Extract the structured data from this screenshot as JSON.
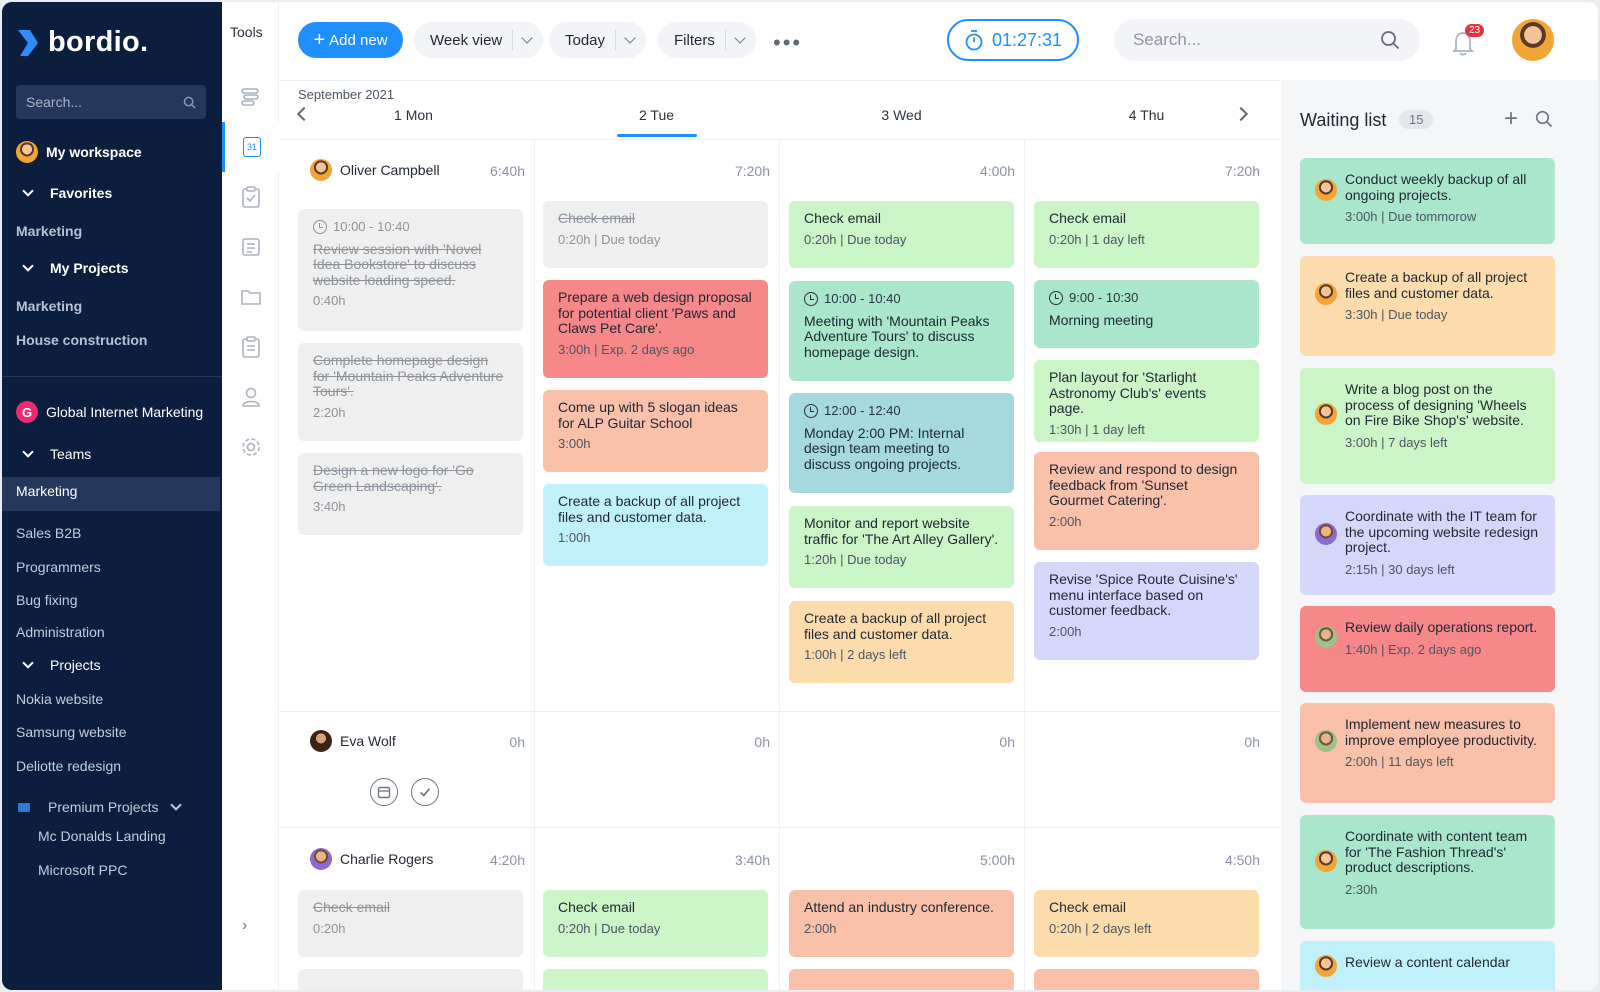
{
  "sidebar": {
    "brand": "bordio.",
    "search_placeholder": "Search...",
    "workspace": "My workspace",
    "favorites": "Favorites",
    "fav_items": [
      "Marketing"
    ],
    "my_projects": "My Projects",
    "project_items": [
      "Marketing",
      "House construction"
    ],
    "org_name": "Global Internet Marketing",
    "org_initial": "G",
    "teams": "Teams",
    "team_items": [
      "Marketing",
      "Sales B2B",
      "Programmers",
      "Bug fixing",
      "Administration"
    ],
    "projects": "Projects",
    "projects_items": [
      "Nokia website",
      "Samsung website",
      "Deliotte redesign"
    ],
    "premium_folder": "Premium Projects",
    "premium_items": [
      "Mc Donalds Landing",
      "Microsoft PPC"
    ]
  },
  "tools": {
    "title": "Tools",
    "calendar_day": "31"
  },
  "toolbar": {
    "add_label": "Add new",
    "view_label": "Week view",
    "today_label": "Today",
    "filters_label": "Filters",
    "timer": "01:27:31",
    "search_placeholder": "Search...",
    "notif_count": "23"
  },
  "calendar": {
    "month": "September 2021",
    "days": [
      "1 Mon",
      "2 Tue",
      "3 Wed",
      "4 Thu"
    ],
    "people": [
      {
        "name": "Oliver Campbell",
        "hours": [
          "6:40h",
          "7:20h",
          "4:00h",
          "7:20h"
        ],
        "columns": [
          [
            {
              "time": "10:00 - 10:40",
              "title": "Review session with 'Novel Idea Bookstore' to discuss website loading speed.",
              "meta": "0:40h",
              "style": "done"
            },
            {
              "title": "Complete homepage design for 'Mountain Peaks Adventure Tours'.",
              "meta": "2:20h",
              "style": "done"
            },
            {
              "title": "Design a new logo for 'Go Green Landscaping'.",
              "meta": "3:40h",
              "style": "done"
            }
          ],
          [
            {
              "title": "Check email",
              "meta": "0:20h | Due today",
              "style": "done"
            },
            {
              "title": "Prepare a web design proposal for potential client 'Paws and Claws Pet Care'.",
              "meta": "3:00h | Exp. 2 days ago",
              "style": "red"
            },
            {
              "title": "Come up with 5 slogan ideas for ALP Guitar School",
              "meta": "3:00h",
              "style": "salmon"
            },
            {
              "title": "Create a backup of all project files and customer data.",
              "meta": "1:00h",
              "style": "cyan"
            }
          ],
          [
            {
              "title": "Check email",
              "meta": "0:20h | Due today",
              "style": "green"
            },
            {
              "time": "10:00 - 10:40",
              "title": "Meeting with 'Mountain Peaks Adventure Tours' to discuss homepage design.",
              "meta": "",
              "style": "teal"
            },
            {
              "time": "12:00 - 12:40",
              "title": "Monday 2:00 PM: Internal design team meeting to discuss ongoing projects.",
              "meta": "",
              "style": "blueteal"
            },
            {
              "title": "Monitor and report website traffic for 'The Art Alley Gallery'.",
              "meta": "1:20h | Due today",
              "style": "green"
            },
            {
              "title": "Create a backup of all project files and customer data.",
              "meta": "1:00h | 2 days left",
              "style": "peach"
            }
          ],
          [
            {
              "title": "Check email",
              "meta": "0:20h | 1 day left",
              "style": "green"
            },
            {
              "time": "9:00 - 10:30",
              "title": "Morning meeting",
              "meta": "",
              "style": "teal"
            },
            {
              "title": "Plan layout for 'Starlight Astronomy Club's' events page.",
              "meta": "1:30h | 1 day left",
              "style": "green"
            },
            {
              "title": "Review and respond to design feedback from 'Sunset Gourmet Catering'.",
              "meta": "2:00h",
              "style": "salmon"
            },
            {
              "title": "Revise 'Spice Route Cuisine's' menu interface based on customer feedback.",
              "meta": "2:00h",
              "style": "lav"
            }
          ]
        ]
      },
      {
        "name": "Eva Wolf",
        "hours": [
          "0h",
          "0h",
          "0h",
          "0h"
        ],
        "columns": [
          [],
          [],
          [],
          []
        ]
      },
      {
        "name": "Charlie Rogers",
        "hours": [
          "4:20h",
          "3:40h",
          "5:00h",
          "4:50h"
        ],
        "columns": [
          [
            {
              "title": "Check email",
              "meta": "0:20h",
              "style": "done"
            }
          ],
          [
            {
              "title": "Check email",
              "meta": "0:20h | Due today",
              "style": "green"
            }
          ],
          [
            {
              "title": "Attend an industry conference.",
              "meta": "2:00h",
              "style": "salmon"
            }
          ],
          [
            {
              "title": "Check email",
              "meta": "0:20h | 2 days left",
              "style": "peach"
            }
          ]
        ]
      }
    ]
  },
  "waiting": {
    "title": "Waiting list",
    "count": "15",
    "items": [
      {
        "title": "Conduct weekly backup of all ongoing projects.",
        "meta": "3:00h | Due tommorow",
        "style": "teal"
      },
      {
        "title": "Create a backup of all project files and customer data.",
        "meta": "3:30h | Due today",
        "style": "peach"
      },
      {
        "title": "Write a blog post on the process of designing 'Wheels on Fire Bike Shop's' website.",
        "meta": "3:00h | 7 days left",
        "style": "green"
      },
      {
        "title": "Coordinate with the IT team for the upcoming website redesign project.",
        "meta": "2:15h | 30 days left",
        "style": "lav"
      },
      {
        "title": "Review daily operations report.",
        "meta": "1:40h | Exp. 2 days ago",
        "style": "red"
      },
      {
        "title": "Implement new measures to improve employee productivity.",
        "meta": "2:00h | 11 days left",
        "style": "salmon"
      },
      {
        "title": "Coordinate with content team for 'The Fashion Thread's' product descriptions.",
        "meta": "2:30h",
        "style": "teal"
      },
      {
        "title": "Review a content calendar",
        "meta": "",
        "style": "cyan"
      }
    ]
  },
  "colors": {
    "accent": "#1f8fff",
    "sidebar_bg": "#0c1e3e",
    "badge": "#e8313c"
  }
}
